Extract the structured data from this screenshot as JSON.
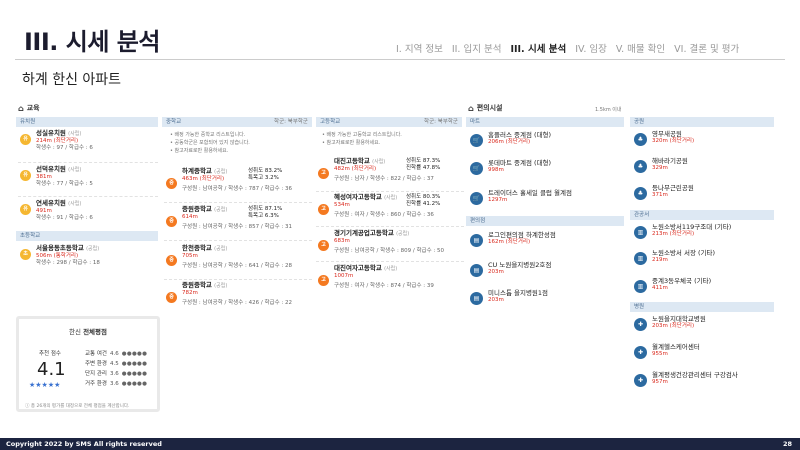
{
  "page": {
    "title": "III. 시세 분석",
    "subtitle": "하계 한신 아파트",
    "nav": [
      "I. 지역 정보",
      "II. 입지 분석",
      "III. 시세 분석",
      "IV. 임장",
      "V. 매물 확인",
      "VI. 결론 및 평가"
    ],
    "nav_active_index": 2,
    "footer": "Copyright 2022 by SMS All rights reserved",
    "page_number": "28"
  },
  "education": {
    "title": "교육",
    "kindergarten": {
      "label": "유치원",
      "items": [
        {
          "icon": "유",
          "name": "성실유치원",
          "tag": "(사립)",
          "dist": "214m (최단거리)",
          "meta": "학생수 : 97 / 학급수 : 6"
        },
        {
          "icon": "유",
          "name": "선덕유치원",
          "tag": "(사립)",
          "dist": "381m",
          "meta": "학생수 : 77 / 학급수 : 5"
        },
        {
          "icon": "유",
          "name": "연세유치원",
          "tag": "(사립)",
          "dist": "491m",
          "meta": "학생수 : 91 / 학급수 : 6"
        }
      ]
    },
    "elementary": {
      "label": "초등학교",
      "items": [
        {
          "icon": "초",
          "name": "서울용동초등학교",
          "tag": "(공립)",
          "dist": "506m (통학거리)",
          "meta": "학생수 : 298 / 학급수 : 18"
        }
      ]
    },
    "middle": {
      "label": "중학교",
      "right": "학군: 북부학군",
      "notes": [
        "• 배정 가능한 중학교 리스트입니다.",
        "• 공동학군은 포함되어 있지 않습니다.",
        "• 참고자료로만 활용하세요."
      ],
      "items": [
        {
          "icon": "중",
          "name": "하계중학교",
          "tag": "(공립)",
          "dist": "463m (최단거리)",
          "meta": "구성원 : 남여공학 / 학생수 : 787 / 학급수 : 36",
          "stat1": "성취도 83.2%",
          "stat2": "특목고 3.2%"
        },
        {
          "icon": "중",
          "name": "중원중학교",
          "tag": "(공립)",
          "dist": "614m",
          "meta": "구성원 : 남여공학 / 학생수 : 857 / 학급수 : 31",
          "stat1": "성취도 87.1%",
          "stat2": "특목고 6.3%"
        },
        {
          "icon": "중",
          "name": "한천중학교",
          "tag": "(공립)",
          "dist": "705m",
          "meta": "구성원 : 남여공학 / 학생수 : 641 / 학급수 : 28"
        },
        {
          "icon": "중",
          "name": "중원중학교",
          "tag": "(공립)",
          "dist": "782m",
          "meta": "구성원 : 남여공학 / 학생수 : 426 / 학급수 : 22"
        }
      ]
    },
    "high": {
      "label": "고등학교",
      "right": "학군: 북부학군",
      "notes": [
        "• 배정 가능한 고등학교 리스트입니다.",
        "• 참고자료로만 활용하세요."
      ],
      "items": [
        {
          "icon": "고",
          "name": "대진고등학교",
          "tag": "(사립)",
          "dist": "482m (최단거리)",
          "meta": "구성원 : 남자 / 학생수 : 822 / 학급수 : 37",
          "stat1": "성취도 87.3%",
          "stat2": "진학률 47.8%"
        },
        {
          "icon": "고",
          "name": "혜성여자고등학교",
          "tag": "(사립)",
          "dist": "534m",
          "meta": "구성원 : 여자 / 학생수 : 860 / 학급수 : 36",
          "stat1": "성취도 80.3%",
          "stat2": "진학률 41.2%"
        },
        {
          "icon": "고",
          "name": "경기기계공업고등학교",
          "tag": "(공립)",
          "dist": "683m",
          "meta": "구성원 : 남여공학 / 학생수 : 809 / 학급수 : 50"
        },
        {
          "icon": "고",
          "name": "대진여자고등학교",
          "tag": "(사립)",
          "dist": "1007m",
          "meta": "구성원 : 여자 / 학생수 : 874 / 학급수 : 39"
        }
      ]
    }
  },
  "rating": {
    "title_prefix": "한신",
    "title_bold": "전체평점",
    "score_label": "추천 점수",
    "score": "4.1",
    "stars": "★★★★★",
    "rows": [
      {
        "label": "교통 여건",
        "score": "4.6",
        "dots": "●●●●●"
      },
      {
        "label": "주변 환경",
        "score": "4.5",
        "dots": "●●●●●"
      },
      {
        "label": "단지 관리",
        "score": "3.6",
        "dots": "●●●●●"
      },
      {
        "label": "거주 환경",
        "score": "3.6",
        "dots": "●●●●●"
      }
    ],
    "footnote": "ⓘ 총 26개의 평가를 대정으로 전체 평점을 계산합니다."
  },
  "facilities": {
    "title": "편의시설",
    "range": "1.5km 이내",
    "mart": {
      "label": "마트",
      "items": [
        {
          "name": "홈플러스 중계점 (대형)",
          "dist": "206m (최단거리)"
        },
        {
          "name": "롯데마트 중계점 (대형)",
          "dist": "998m"
        },
        {
          "name": "트레이더스 홀세일 클럽 월계점",
          "dist": "1297m"
        }
      ]
    },
    "convenience": {
      "label": "편의점",
      "items": [
        {
          "name": "로그인편의점 하계한성점",
          "dist": "162m (최단거리)"
        },
        {
          "name": "CU 노원을지병원2호점",
          "dist": "203m"
        },
        {
          "name": "미니스톱 을지병원1점",
          "dist": "203m"
        }
      ]
    },
    "park": {
      "label": "공원",
      "items": [
        {
          "name": "영무새공원",
          "dist": "320m (최단거리)"
        },
        {
          "name": "해바라기공원",
          "dist": "329m"
        },
        {
          "name": "등나무근린공원",
          "dist": "371m"
        }
      ]
    },
    "public": {
      "label": "관공서",
      "items": [
        {
          "name": "노원소방서119구조대 (기타)",
          "dist": "213m (최단거리)"
        },
        {
          "name": "노원소방서 서장 (기타)",
          "dist": "219m"
        },
        {
          "name": "중계3동우체국 (기타)",
          "dist": "411m"
        }
      ]
    },
    "hospital": {
      "label": "병원",
      "items": [
        {
          "name": "노원을지대학교병원",
          "dist": "203m (최단거리)"
        },
        {
          "name": "월계헬스케어센터",
          "dist": "955m"
        },
        {
          "name": "월계평생건강관리센터 구강검사",
          "dist": "957m"
        }
      ]
    }
  }
}
